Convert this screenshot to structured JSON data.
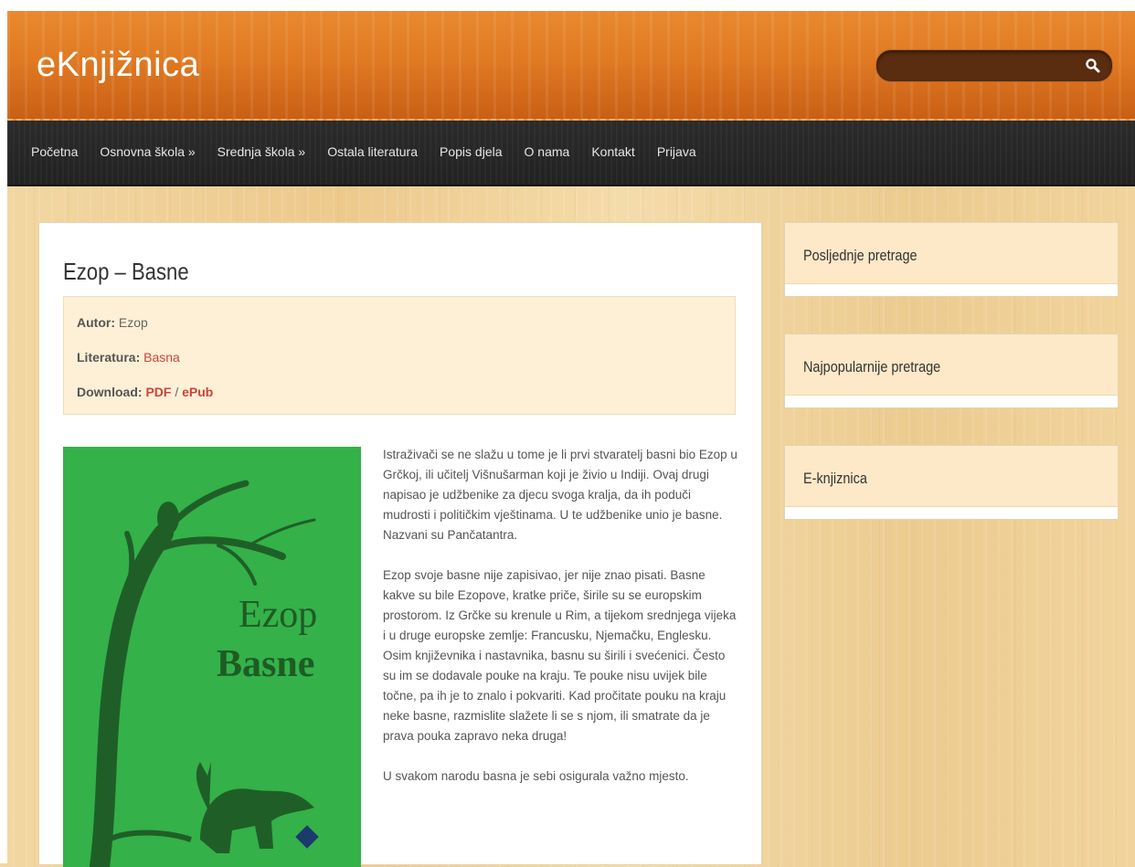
{
  "site": {
    "logo": "eKnjižnica"
  },
  "search": {
    "placeholder": ""
  },
  "nav": {
    "items": [
      "Početna",
      "Osnovna škola »",
      "Srednja škola »",
      "Ostala literatura",
      "Popis djela",
      "O nama",
      "Kontakt",
      "Prijava"
    ]
  },
  "post": {
    "title": "Ezop – Basne",
    "meta": {
      "author_label": "Autor:",
      "author": "Ezop",
      "literature_label": "Literatura:",
      "literature": "Basna",
      "download_label": "Download:",
      "pdf": "PDF",
      "sep": "/",
      "epub": "ePub"
    },
    "cover": {
      "line1": "Ezop",
      "line2": "Basne"
    },
    "paragraphs": [
      "Istraživači se ne slažu u tome je li prvi stvaratelj basni bio Ezop u Grčkoj, ili učitelj Višnušarman koji je živio u Indiji. Ovaj drugi napisao je udžbenike za djecu svoga kralja, da ih poduči mudrosti i političkim vještinama. U te udžbenike unio je basne. Nazvani su Pančatantra.",
      "Ezop svoje basne nije zapisivao, jer nije znao pisati. Basne kakve su bile Ezopove, kratke priče, širile su se europskim prostorom. Iz Grčke su krenule u Rim, a tijekom srednjega vijeka i u druge europske zemlje: Francusku, Njemačku, Englesku. Osim književnika i nastavnika, basnu su širili i svećenici. Često su im se dodavale pouke na kraju. Te pouke nisu uvijek bile točne, pa ih je to znalo i pokvariti. Kad pročitate pouku na kraju neke basne, razmislite slažete li se s njom, ili smatrate da je prava pouka zapravo neka druga!",
      "U svakom narodu basna je sebi osigurala važno mjesto."
    ]
  },
  "sidebar": {
    "widgets": [
      "Posljednje pretrage",
      "Najpopularnije pretrage",
      "E-knjiznica"
    ]
  },
  "colors": {
    "accent_link": "#c9453e",
    "header_orange": "#e07a23",
    "nav_dark": "#262626",
    "cover_green": "#34b149"
  }
}
